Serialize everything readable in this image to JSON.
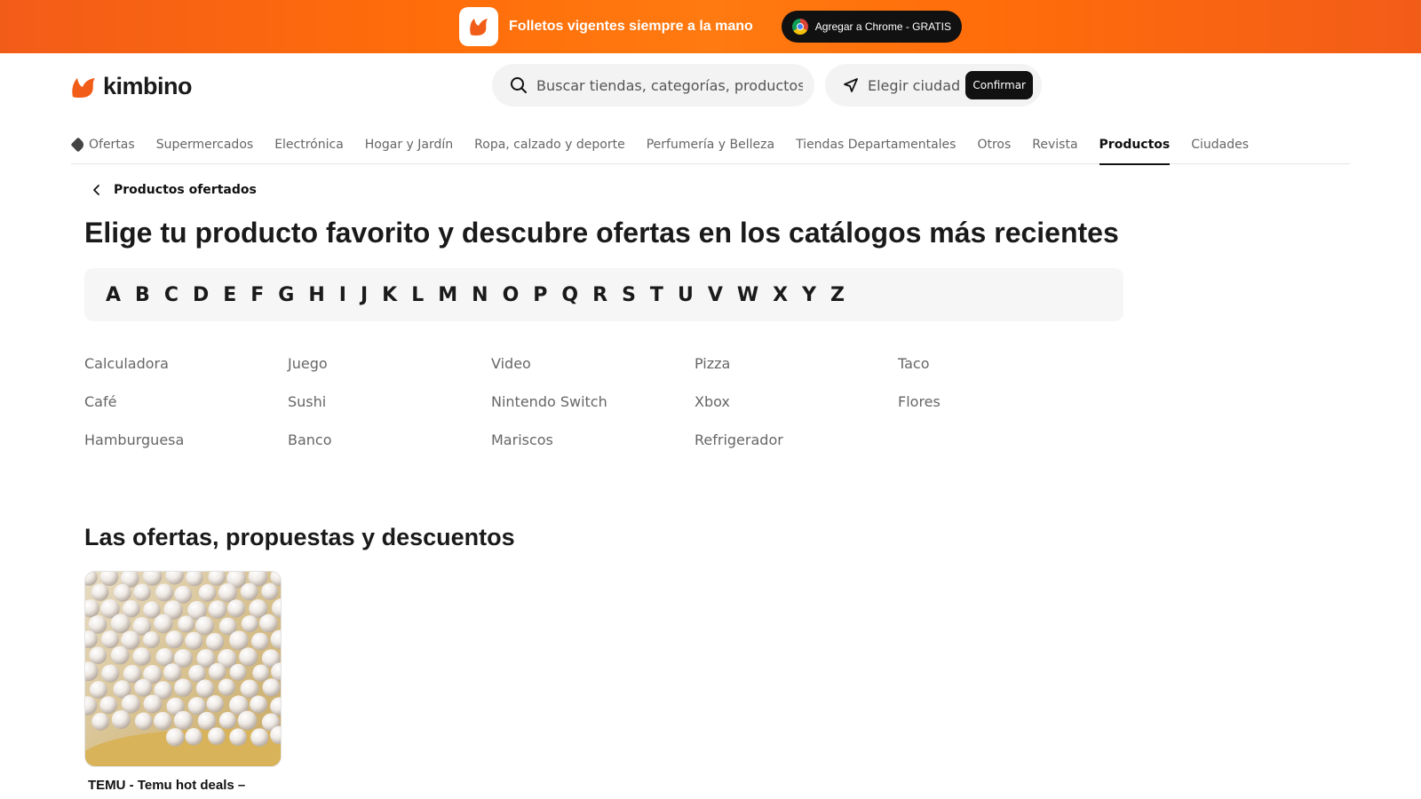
{
  "promo": {
    "text": "Folletos vigentes siempre a la mano",
    "button": "Agregar a Chrome - GRATIS"
  },
  "header": {
    "logo": "kimbino",
    "search_placeholder": "Buscar tiendas, categorías, productos...",
    "city_label": "Elegir ciudad",
    "confirm": "Confirmar"
  },
  "nav": {
    "items": [
      {
        "label": "Ofertas"
      },
      {
        "label": "Supermercados"
      },
      {
        "label": "Electrónica"
      },
      {
        "label": "Hogar y Jardín"
      },
      {
        "label": "Ropa, calzado y deporte"
      },
      {
        "label": "Perfumería y Belleza"
      },
      {
        "label": "Tiendas Departamentales"
      },
      {
        "label": "Otros"
      },
      {
        "label": "Revista"
      },
      {
        "label": "Productos"
      },
      {
        "label": "Ciudades"
      }
    ],
    "active": "Productos"
  },
  "breadcrumb": {
    "label": "Productos ofertados"
  },
  "page_title": "Elige tu producto favorito y descubre ofertas en los catálogos más recientes",
  "alphabet": [
    "A",
    "B",
    "C",
    "D",
    "E",
    "F",
    "G",
    "H",
    "I",
    "J",
    "K",
    "L",
    "M",
    "N",
    "O",
    "P",
    "Q",
    "R",
    "S",
    "T",
    "U",
    "V",
    "W",
    "X",
    "Y",
    "Z"
  ],
  "products": [
    "Calculadora",
    "Juego",
    "Video",
    "Pizza",
    "Taco",
    "Café",
    "Sushi",
    "Nintendo Switch",
    "Xbox",
    "Flores",
    "Hamburguesa",
    "Banco",
    "Mariscos",
    "Refrigerador"
  ],
  "section_title": "Las ofertas, propuestas y descuentos",
  "card": {
    "title": "TEMU - Temu hot deals –"
  },
  "colors": {
    "brand": "#ff6d0a",
    "dark": "#111111"
  }
}
